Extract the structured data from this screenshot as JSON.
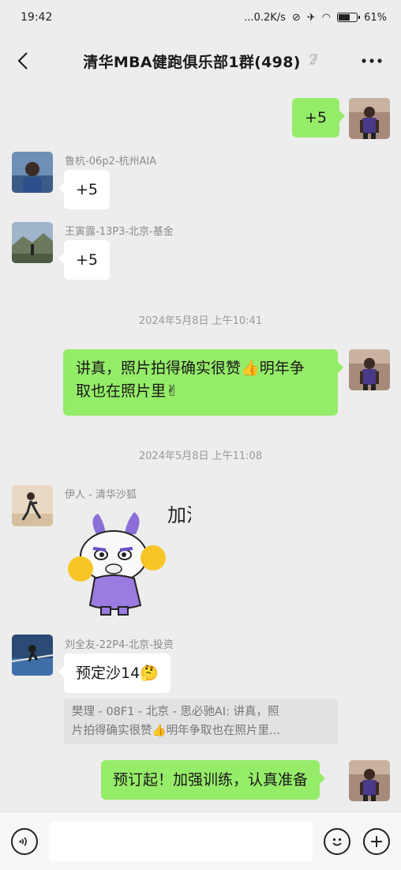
{
  "status_bar": {
    "time": "19:42",
    "network_speed": "...0.2K/s",
    "battery": "61%"
  },
  "header": {
    "back_icon": "chevron-left-icon",
    "title": "清华MBA健跑俱乐部1群(498)",
    "mute_icon": "ear-muted-icon",
    "more_icon": "more-dots-icon"
  },
  "messages": [
    {
      "side": "out",
      "text": "+5"
    },
    {
      "side": "in",
      "sender": "鲁杭-06p2-杭州AIA",
      "text": "+5"
    },
    {
      "side": "in",
      "sender": "王寅露-13P3-北京-基金",
      "text": "+5"
    },
    {
      "type": "time",
      "text": "2024年5月8日 上午10:41"
    },
    {
      "side": "out",
      "line1": "讲真，照片拍得确实很赞",
      "line1_emoji": "👍",
      "line1_end": "明年争",
      "line2": "取也在照片里",
      "line2_emoji": "✌"
    },
    {
      "type": "time",
      "text": "2024年5月8日 上午11:08"
    },
    {
      "side": "in",
      "sender": "伊人 - 清华沙狐",
      "sticker": "dragon-cheer-sticker",
      "sticker_text": "加油"
    },
    {
      "side": "in",
      "sender": "刘全友-22P4-北京-投资",
      "text": "预定沙14",
      "emoji": "🤔",
      "quote_line1": "樊理 - 08F1 - 北京 - 思必驰AI: 讲真，照",
      "quote_line2a": "片拍得确实很赞",
      "quote_emoji": "👍",
      "quote_line2b": "明年争取也在照片里..."
    },
    {
      "side": "out",
      "text": "预订起！加强训练，认真准备"
    }
  ],
  "input_bar": {
    "voice_icon": "voice-icon",
    "emoji_icon": "emoji-face-icon",
    "plus_icon": "plus-icon"
  },
  "colors": {
    "background": "#ededed",
    "out_bubble": "#95ec69",
    "in_bubble": "#ffffff"
  }
}
